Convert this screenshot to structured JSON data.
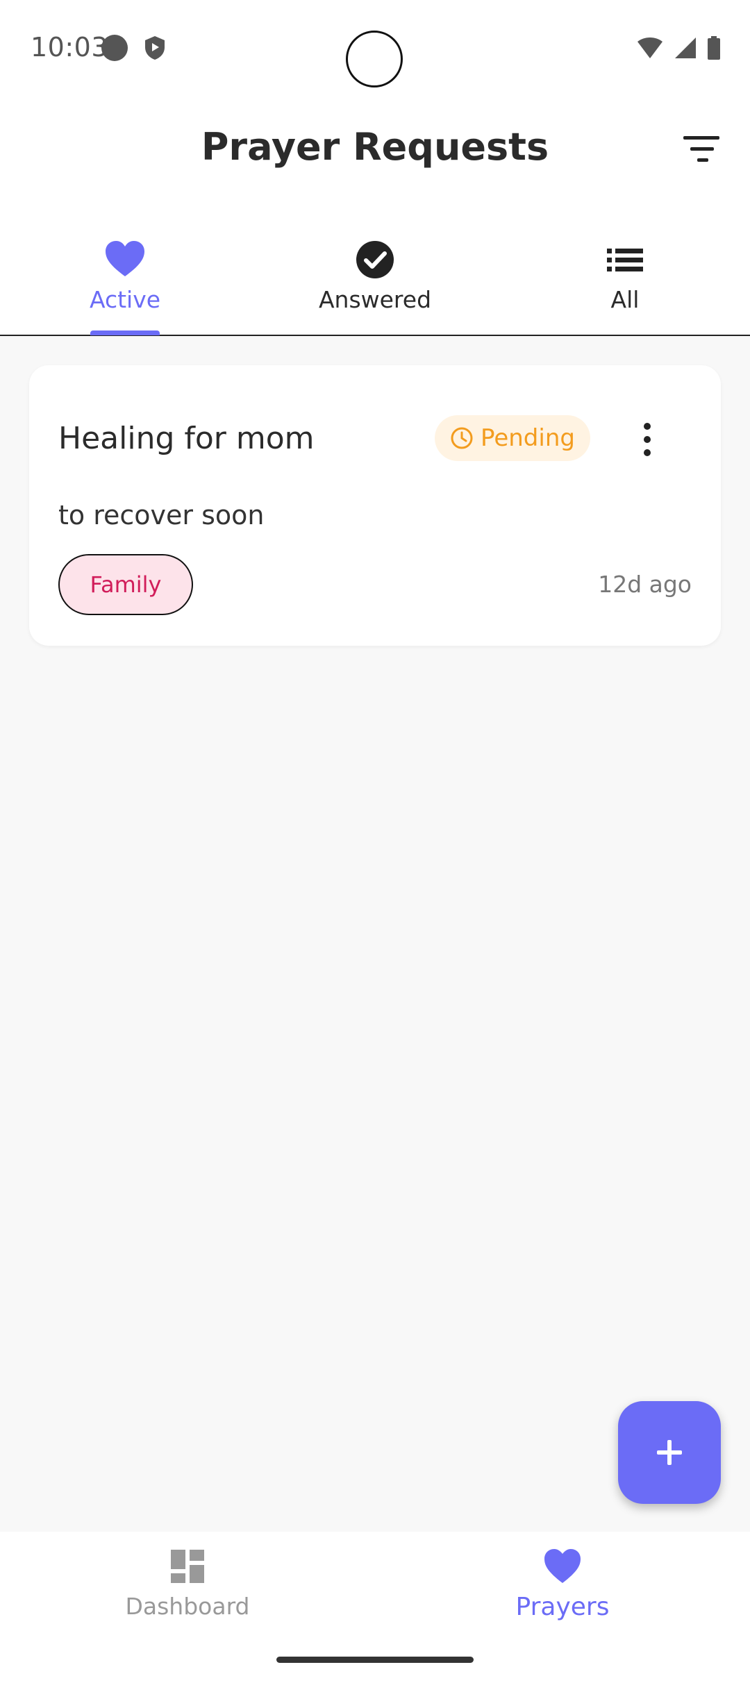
{
  "status_bar": {
    "time": "10:03"
  },
  "header": {
    "title": "Prayer Requests"
  },
  "tabs": [
    {
      "label": "Active",
      "icon": "heart-icon",
      "active": true
    },
    {
      "label": "Answered",
      "icon": "check-circle-icon",
      "active": false
    },
    {
      "label": "All",
      "icon": "list-icon",
      "active": false
    }
  ],
  "prayers": [
    {
      "title": "Healing for mom",
      "status": "Pending",
      "description": "to recover soon",
      "category": "Family",
      "time": "12d ago"
    }
  ],
  "bottom_nav": [
    {
      "label": "Dashboard",
      "icon": "dashboard-icon",
      "active": false
    },
    {
      "label": "Prayers",
      "icon": "heart-icon",
      "active": true
    }
  ],
  "colors": {
    "accent": "#6b6cf6",
    "pending": "#f39c1e",
    "pending_bg": "#fff3e2",
    "tag_text": "#d11d5a",
    "tag_bg": "#fde3ea"
  }
}
